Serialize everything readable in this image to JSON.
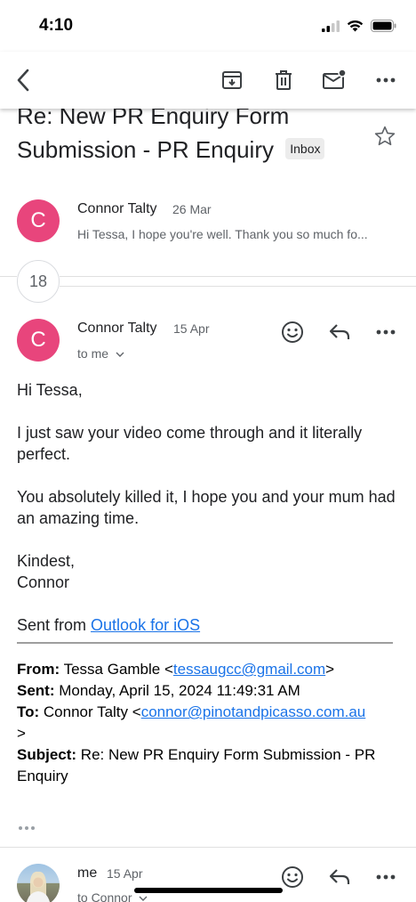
{
  "status": {
    "time": "4:10"
  },
  "thread": {
    "subject": "Re: New PR Enquiry Form Submission - PR Enquiry",
    "label": "Inbox",
    "collapsed_count": "18"
  },
  "messages": [
    {
      "initial": "C",
      "sender": "Connor Talty",
      "date": "26 Mar",
      "snippet": "Hi Tessa, I hope you're well. Thank you so much fo..."
    },
    {
      "initial": "C",
      "sender": "Connor Talty",
      "date": "15 Apr",
      "recipient": "to me",
      "body": {
        "greeting": "Hi Tessa,",
        "para1": "I just saw your video come through and it literally perfect.",
        "para2": "You absolutely killed it, I hope you and your mum had an amazing time.",
        "signoff1": "Kindest,",
        "signoff2": "Connor",
        "sent_from_prefix": "Sent from ",
        "sent_from_link": "Outlook for iOS"
      },
      "quoted": {
        "from_label": "From:",
        "from_name": " Tessa Gamble <",
        "from_email": "tessaugcc@gmail.com",
        "from_close": ">",
        "sent_label": "Sent:",
        "sent_value": " Monday, April 15, 2024 11:49:31 AM",
        "to_label": "To:",
        "to_name": " Connor Talty <",
        "to_email": "connor@pinotandpicasso.com.au",
        "to_close": ">",
        "subject_label": "Subject:",
        "subject_value": " Re: New PR Enquiry Form Submission - PR Enquiry"
      }
    },
    {
      "sender": "me",
      "date": "15 Apr",
      "recipient": "to Connor"
    }
  ],
  "icons": [
    "back-icon",
    "archive-icon",
    "trash-icon",
    "mark-unread-icon",
    "more-icon",
    "star-icon",
    "emoji-icon",
    "reply-icon",
    "chevron-down-icon"
  ],
  "colors": {
    "avatar": "#e8457c",
    "link": "#1a73e8"
  }
}
